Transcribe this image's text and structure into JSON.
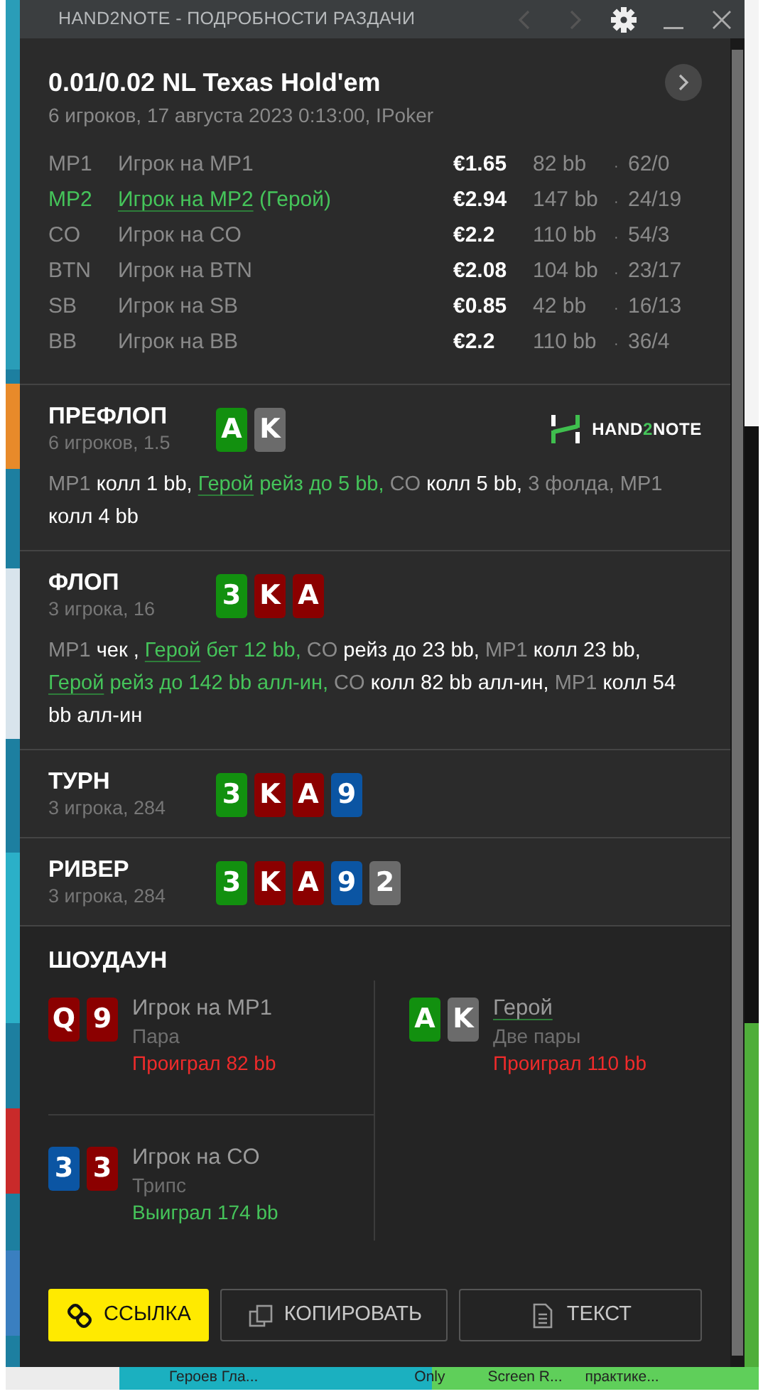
{
  "window": {
    "title": "HAND2NOTE - ПОДРОБНОСТИ РАЗДАЧИ",
    "back_disabled": true,
    "forward_disabled": true
  },
  "header": {
    "game": "0.01/0.02 NL Texas Hold'em",
    "info": "6 игроков, 17 августа 2023 0:13:00, IPoker",
    "players": [
      {
        "position": "MP1",
        "name": "Игрок на MP1",
        "hero": false,
        "stack": "€1.65",
        "bb": "82 bb",
        "separator": "·",
        "stats": "62/0"
      },
      {
        "position": "MP2",
        "name": "Игрок на MP2",
        "tag": "(Герой)",
        "hero": true,
        "stack": "€2.94",
        "bb": "147 bb",
        "separator": "·",
        "stats": "24/19"
      },
      {
        "position": "CO",
        "name": "Игрок на CO",
        "hero": false,
        "stack": "€2.2",
        "bb": "110 bb",
        "separator": "·",
        "stats": "54/3"
      },
      {
        "position": "BTN",
        "name": "Игрок на BTN",
        "hero": false,
        "stack": "€2.08",
        "bb": "104 bb",
        "separator": "·",
        "stats": "23/17"
      },
      {
        "position": "SB",
        "name": "Игрок на SB",
        "hero": false,
        "stack": "€0.85",
        "bb": "42 bb",
        "separator": "·",
        "stats": "16/13"
      },
      {
        "position": "BB",
        "name": "Игрок на BB",
        "hero": false,
        "stack": "€2.2",
        "bb": "110 bb",
        "separator": "·",
        "stats": "36/4"
      }
    ]
  },
  "logo": {
    "left": "HAND",
    "middle": "2",
    "right": "NOTE"
  },
  "streets": [
    {
      "name": "ПРЕФЛОП",
      "info": "6 игроков, 1.5",
      "logo": true,
      "cards": [
        {
          "rank": "A",
          "color": "#12900f"
        },
        {
          "rank": "K",
          "color": "#6b6b6b"
        }
      ],
      "actions": [
        {
          "kind": "player",
          "text": "MP1"
        },
        {
          "kind": "act",
          "text": "колл 1 bb,"
        },
        {
          "kind": "hero",
          "text": "Герой"
        },
        {
          "kind": "heroact",
          "text": "рейз до 5 bb,"
        },
        {
          "kind": "player",
          "text": "CO"
        },
        {
          "kind": "act",
          "text": "колл 5 bb,"
        },
        {
          "kind": "player",
          "text": "3 фолда,"
        },
        {
          "kind": "player",
          "text": "MP1"
        },
        {
          "kind": "act",
          "text": "колл 4 bb"
        }
      ]
    },
    {
      "name": "ФЛОП",
      "info": "3 игрока, 16",
      "logo": false,
      "cards": [
        {
          "rank": "3",
          "color": "#12900f"
        },
        {
          "rank": "K",
          "color": "#8b0000"
        },
        {
          "rank": "A",
          "color": "#8b0000"
        }
      ],
      "actions": [
        {
          "kind": "player",
          "text": "MP1"
        },
        {
          "kind": "act",
          "text": "чек ,"
        },
        {
          "kind": "hero",
          "text": "Герой"
        },
        {
          "kind": "heroact",
          "text": "бет 12 bb,"
        },
        {
          "kind": "player",
          "text": "CO"
        },
        {
          "kind": "act",
          "text": "рейз до 23 bb,"
        },
        {
          "kind": "player",
          "text": "MP1"
        },
        {
          "kind": "act",
          "text": "колл 23 bb,"
        },
        {
          "kind": "hero",
          "text": "Герой"
        },
        {
          "kind": "heroact",
          "text": "рейз до 142 bb алл-ин,"
        },
        {
          "kind": "player",
          "text": "CO"
        },
        {
          "kind": "act",
          "text": "колл 82 bb алл-ин,"
        },
        {
          "kind": "player",
          "text": "MP1"
        },
        {
          "kind": "act",
          "text": "колл 54 bb алл-ин"
        }
      ]
    },
    {
      "name": "ТУРН",
      "info": "3 игрока, 284",
      "logo": false,
      "cards": [
        {
          "rank": "3",
          "color": "#12900f"
        },
        {
          "rank": "K",
          "color": "#8b0000"
        },
        {
          "rank": "A",
          "color": "#8b0000"
        },
        {
          "rank": "9",
          "color": "#0b55a3"
        }
      ]
    },
    {
      "name": "РИВЕР",
      "info": "3 игрока, 284",
      "logo": false,
      "cards": [
        {
          "rank": "3",
          "color": "#12900f"
        },
        {
          "rank": "K",
          "color": "#8b0000"
        },
        {
          "rank": "A",
          "color": "#8b0000"
        },
        {
          "rank": "9",
          "color": "#0b55a3"
        },
        {
          "rank": "2",
          "color": "#6b6b6b"
        }
      ]
    }
  ],
  "showdown": {
    "title": "ШОУДАУН",
    "players": [
      {
        "name": "Игрок на MP1",
        "hero": false,
        "hand": "Пара",
        "result": "Проиграл 82 bb",
        "won": false,
        "cards": [
          {
            "rank": "Q",
            "color": "#8b0000"
          },
          {
            "rank": "9",
            "color": "#8b0000"
          }
        ]
      },
      {
        "name": "Герой",
        "hero": true,
        "hand": "Две пары",
        "result": "Проиграл 110 bb",
        "won": false,
        "cards": [
          {
            "rank": "A",
            "color": "#12900f"
          },
          {
            "rank": "K",
            "color": "#6b6b6b"
          }
        ]
      },
      {
        "name": "Игрок на CO",
        "hero": false,
        "hand": "Трипс",
        "result": "Выиграл 174 bb",
        "won": true,
        "cards": [
          {
            "rank": "3",
            "color": "#0b55a3"
          },
          {
            "rank": "3",
            "color": "#8b0000"
          }
        ]
      }
    ]
  },
  "buttons": [
    {
      "kind": "link",
      "label": "ССЫЛКА"
    },
    {
      "kind": "copy",
      "label": "КОПИРОВАТЬ"
    },
    {
      "kind": "text",
      "label": "ТЕКСТ"
    }
  ],
  "desktop_labels": [
    "Героев Гла...",
    "Only",
    "Screen R...",
    "практике..."
  ]
}
